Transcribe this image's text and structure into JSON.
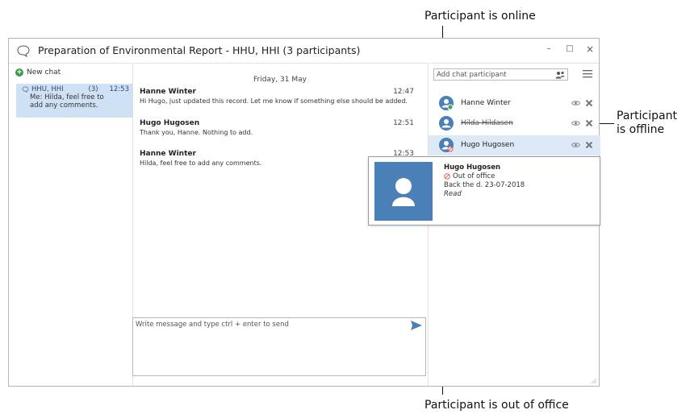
{
  "callouts": {
    "online": "Participant is online",
    "offline_line1": "Participant",
    "offline_line2": "is offline",
    "out_of_office": "Participant is out of office"
  },
  "window": {
    "title": "Preparation of Environmental Report  - HHU, HHI (3 participants)",
    "minimize": "–",
    "maximize": "□",
    "close": "×"
  },
  "sidebar": {
    "new_chat_label": "New chat",
    "chats": [
      {
        "name": "HHU, HHI",
        "count": "(3)",
        "time": "12:53",
        "preview": "Me: Hilda, feel free to add any comments."
      }
    ]
  },
  "conversation": {
    "date": "Friday, 31 May",
    "messages": [
      {
        "sender": "Hanne Winter",
        "time": "12:47",
        "text": "Hi Hugo, just updated this record. Let me know if something else should be added."
      },
      {
        "sender": "Hugo Hugosen",
        "time": "12:51",
        "text": "Thank you, Hanne. Nothing to add."
      },
      {
        "sender": "Hanne Winter",
        "time": "12:53",
        "text": "Hilda, feel free to add any comments."
      }
    ],
    "compose_placeholder": "Write message and type ctrl + enter to send"
  },
  "participants_panel": {
    "add_placeholder": "Add chat participant",
    "participants": [
      {
        "name": "Hanne Winter",
        "status": "online"
      },
      {
        "name": "Hilda Hildasen",
        "status": "offline"
      },
      {
        "name": "Hugo Hugosen",
        "status": "out-of-office"
      }
    ]
  },
  "tooltip": {
    "name": "Hugo Hugosen",
    "status": "Out of office",
    "back": "Back the d. 23-07-2018",
    "read": "Read"
  },
  "colors": {
    "accent": "#4a7fb8",
    "selected": "#cfe1f4",
    "online": "#3aa64a",
    "out_of_office": "#e05050"
  }
}
